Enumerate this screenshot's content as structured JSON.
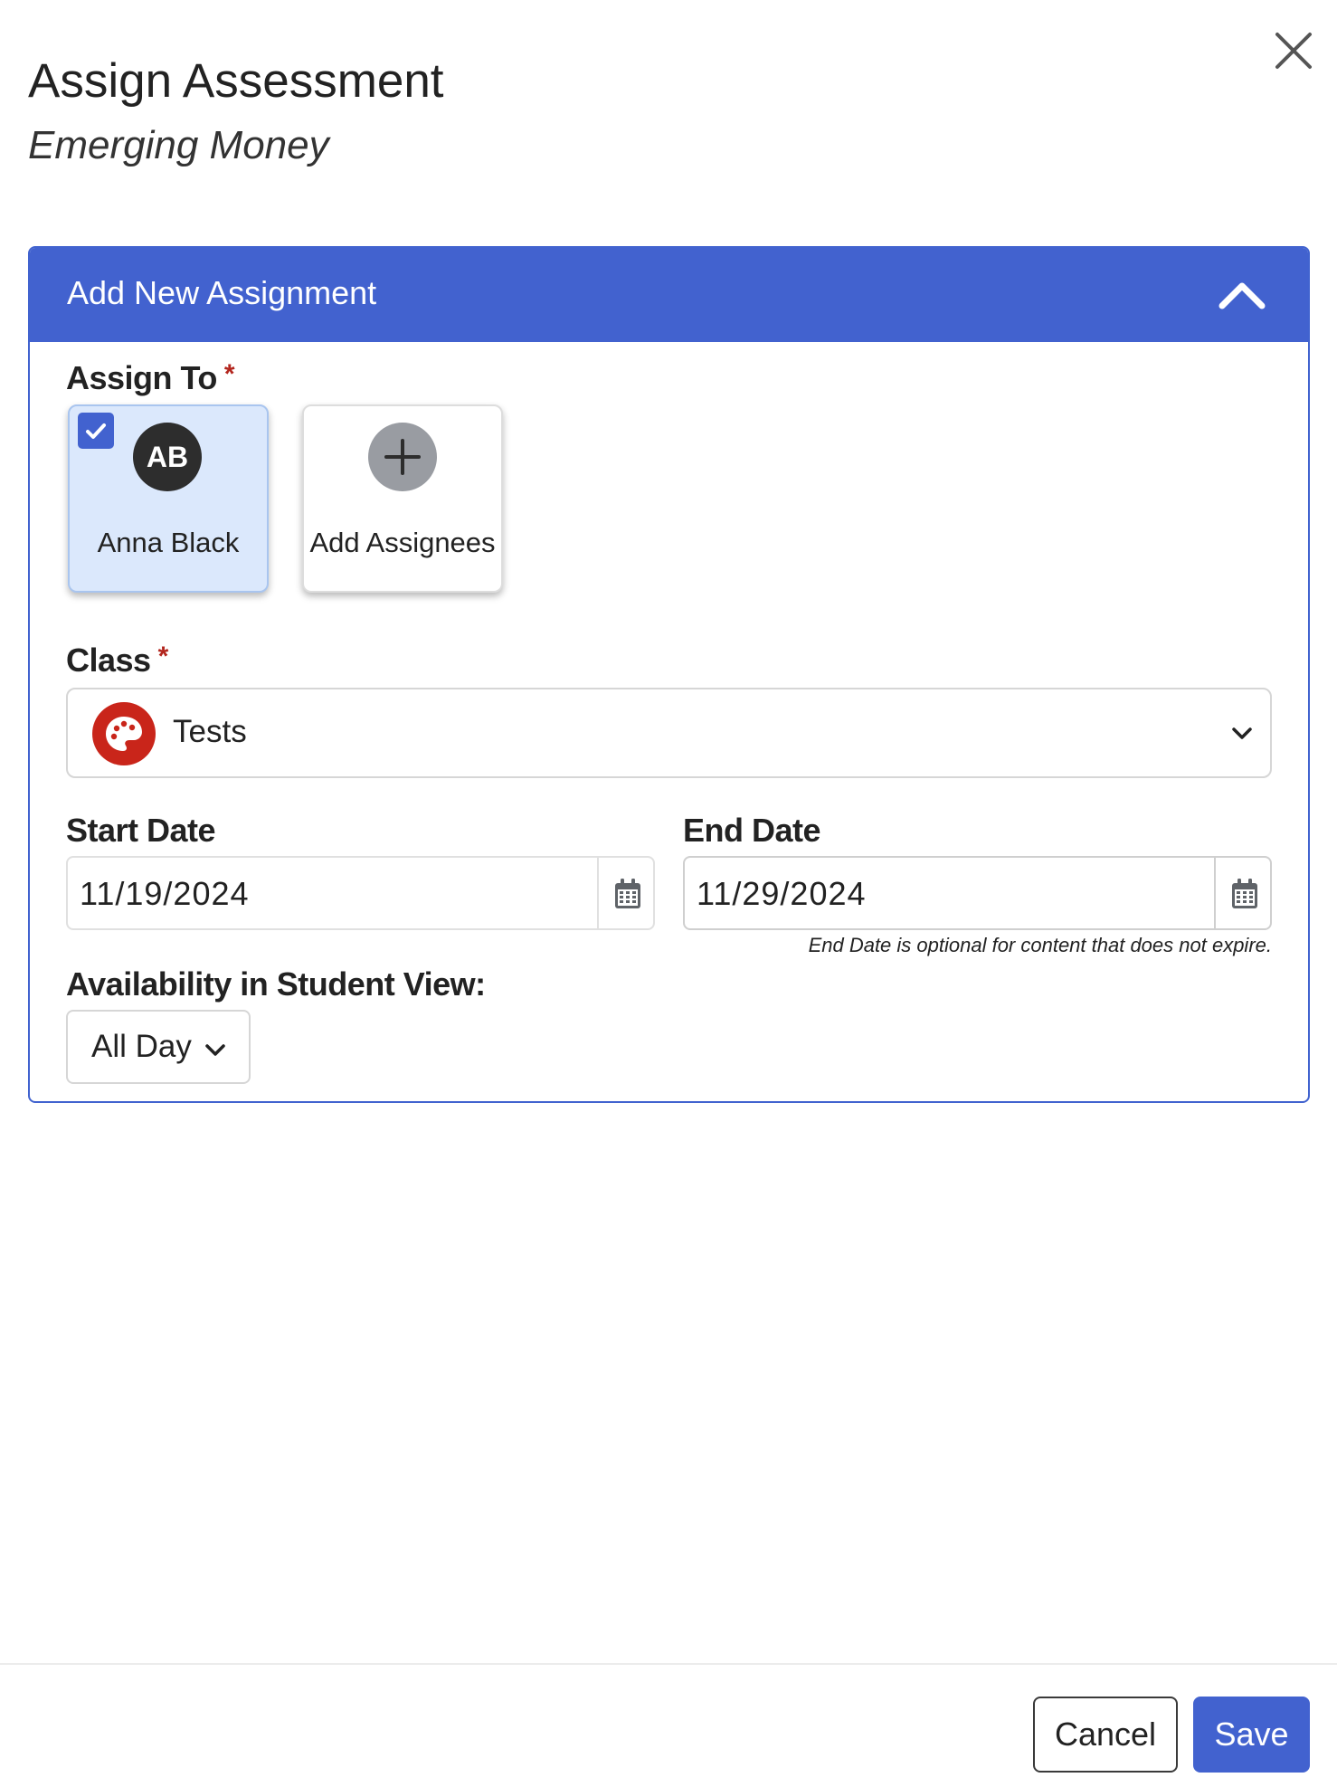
{
  "dialog": {
    "title": "Assign Assessment",
    "subtitle": "Emerging Money"
  },
  "panel": {
    "title": "Add New Assignment",
    "accent_color": "#4262cf"
  },
  "assign_to": {
    "label": "Assign To",
    "required_mark": "*",
    "assignees": [
      {
        "initials": "AB",
        "name": "Anna Black",
        "selected": true
      }
    ],
    "add_label": "Add Assignees"
  },
  "class_field": {
    "label": "Class",
    "required_mark": "*",
    "value": "Tests",
    "icon": "palette-icon",
    "icon_color": "#c9251a"
  },
  "start_date": {
    "label": "Start Date",
    "value": "11/19/2024"
  },
  "end_date": {
    "label": "End Date",
    "value": "11/29/2024",
    "hint": "End Date is optional for content that does not expire."
  },
  "availability": {
    "label": "Availability in Student View:",
    "value": "All Day"
  },
  "footer": {
    "cancel_label": "Cancel",
    "save_label": "Save"
  }
}
